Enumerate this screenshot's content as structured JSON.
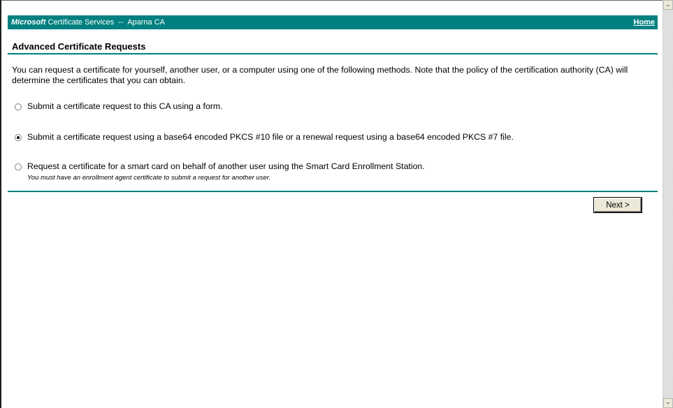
{
  "header": {
    "brand": "Microsoft",
    "service_title": "Certificate Services  --  Aparna CA",
    "home_link": "Home",
    "bar_color": "#008080"
  },
  "page": {
    "title": "Advanced Certificate Requests",
    "intro": "You can request a certificate for yourself, another user, or a computer using one of the following methods. Note that the policy of the certification authority (CA) will determine the certificates that you can obtain."
  },
  "options": [
    {
      "label": "Submit a certificate request to this CA using a form.",
      "checked": false
    },
    {
      "label": "Submit a certificate request using a base64 encoded PKCS #10 file or a renewal request using a base64 encoded PKCS #7 file.",
      "checked": true
    },
    {
      "label": "Request a certificate for a smart card on behalf of another user using the Smart Card Enrollment Station.",
      "note": "You must have an enrollment agent certificate to submit a request for another user.",
      "checked": false
    }
  ],
  "actions": {
    "next_label": "Next >"
  },
  "scrollbar": {
    "up_icon": "arrow-up-icon",
    "down_icon": "arrow-down-icon"
  }
}
